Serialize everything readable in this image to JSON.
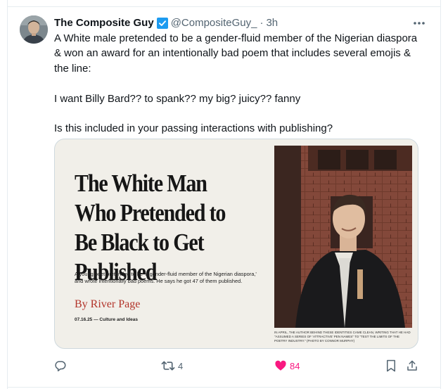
{
  "tweet": {
    "author": {
      "display_name": "The Composite Guy",
      "handle": "@CompositeGuy_",
      "time": "3h",
      "separator": "·"
    },
    "text_lines": [
      "A White male pretended to be a gender-fluid member of the Nigerian diaspora & won an award for an intentionally bad poem that includes several emojis & the line:",
      "I want Billy Bard?? to spank?? my big? juicy?? fanny",
      "Is this included in your passing interactions with publishing?"
    ],
    "media": {
      "headline": "The White Man Who Pretended to Be Black to Get Published",
      "subhead": "A young poet pretended to be 'a gender-fluid member of the Nigerian diaspora,' and wrote intentionally bad poems. He says he got 47 of them published.",
      "byline": "By River Page",
      "dateline": "07.16.25 — Culture and Ideas",
      "caption": "In April, the author behind these identities came clean, writing that he had \"assumed a series of 'attractive' pen names\" to \"test the limits of the poetry industry.\" (Photo by Connor Murphy)"
    },
    "actions": {
      "reply_count": "",
      "retweet_count": "4",
      "like_count": "84"
    }
  },
  "colors": {
    "accent_blue": "#1d9bf0",
    "like_pink": "#f91880",
    "secondary_text": "#536471",
    "byline_red": "#b2342a"
  },
  "icons": [
    "avatar",
    "verified-badge-icon",
    "more-icon",
    "reply-icon",
    "retweet-icon",
    "heart-icon",
    "bookmark-icon",
    "share-icon"
  ]
}
